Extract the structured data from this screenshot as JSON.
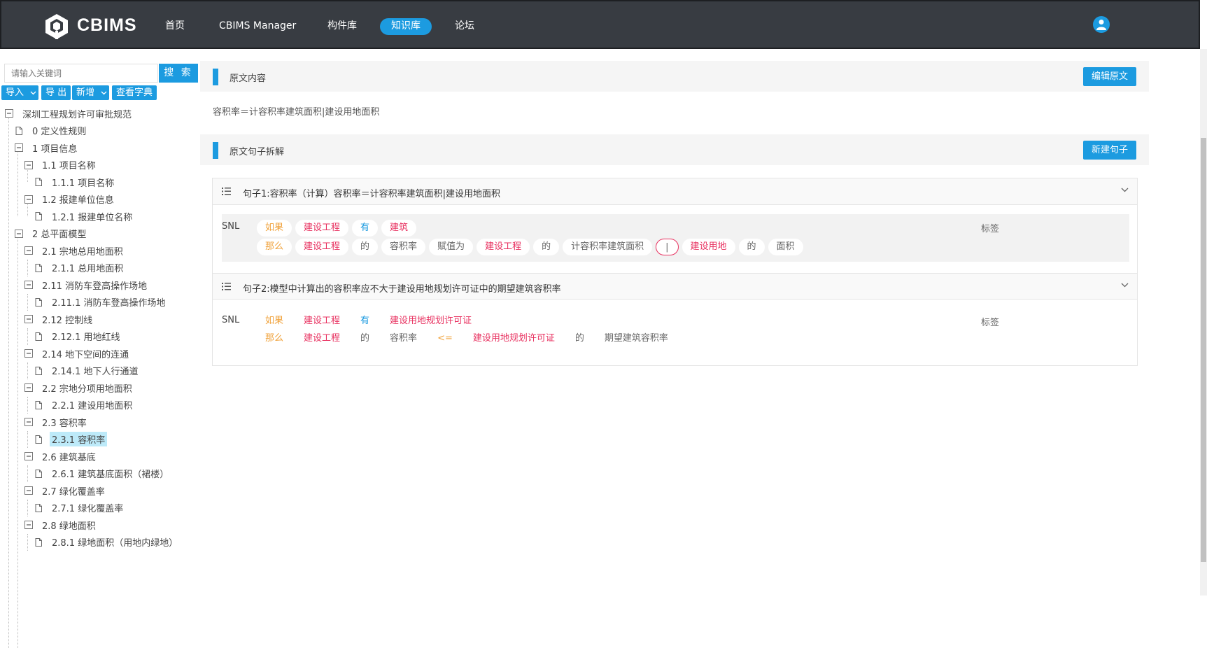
{
  "header": {
    "brand": "CBIMS",
    "nav": [
      "首页",
      "CBIMS Manager",
      "构件库",
      "知识库",
      "论坛"
    ],
    "active_nav": "知识库"
  },
  "sidebar": {
    "search_placeholder": "请输入关键词",
    "search_button": "搜 索",
    "tools": {
      "import": "导入",
      "export": "导 出",
      "add": "新增",
      "dictionary": "查看字典"
    },
    "tree": [
      {
        "label": "深圳工程规划许可审批规范",
        "level": 0,
        "type": "folder"
      },
      {
        "label": "0 定义性规则",
        "level": 1,
        "type": "file"
      },
      {
        "label": "1 项目信息",
        "level": 1,
        "type": "folder"
      },
      {
        "label": "1.1 项目名称",
        "level": 2,
        "type": "folder"
      },
      {
        "label": "1.1.1 项目名称",
        "level": 3,
        "type": "file"
      },
      {
        "label": "1.2 报建单位信息",
        "level": 2,
        "type": "folder"
      },
      {
        "label": "1.2.1 报建单位名称",
        "level": 3,
        "type": "file"
      },
      {
        "label": "2 总平面模型",
        "level": 1,
        "type": "folder"
      },
      {
        "label": "2.1 宗地总用地面积",
        "level": 2,
        "type": "folder"
      },
      {
        "label": "2.1.1 总用地面积",
        "level": 3,
        "type": "file"
      },
      {
        "label": "2.11 消防车登高操作场地",
        "level": 2,
        "type": "folder"
      },
      {
        "label": "2.11.1 消防车登高操作场地",
        "level": 3,
        "type": "file"
      },
      {
        "label": "2.12 控制线",
        "level": 2,
        "type": "folder"
      },
      {
        "label": "2.12.1 用地红线",
        "level": 3,
        "type": "file"
      },
      {
        "label": "2.14 地下空间的连通",
        "level": 2,
        "type": "folder"
      },
      {
        "label": "2.14.1 地下人行通道",
        "level": 3,
        "type": "file"
      },
      {
        "label": "2.2 宗地分项用地面积",
        "level": 2,
        "type": "folder"
      },
      {
        "label": "2.2.1 建设用地面积",
        "level": 3,
        "type": "file"
      },
      {
        "label": "2.3 容积率",
        "level": 2,
        "type": "folder"
      },
      {
        "label": "2.3.1 容积率",
        "level": 3,
        "type": "file",
        "selected": true
      },
      {
        "label": "2.6 建筑基底",
        "level": 2,
        "type": "folder"
      },
      {
        "label": "2.6.1 建筑基底面积（裙楼）",
        "level": 3,
        "type": "file"
      },
      {
        "label": "2.7 绿化覆盖率",
        "level": 2,
        "type": "folder"
      },
      {
        "label": "2.7.1 绿化覆盖率",
        "level": 3,
        "type": "file"
      },
      {
        "label": "2.8 绿地面积",
        "level": 2,
        "type": "folder"
      },
      {
        "label": "2.8.1 绿地面积（用地内绿地）",
        "level": 3,
        "type": "file"
      }
    ]
  },
  "original": {
    "title": "原文内容",
    "edit_button": "编辑原文",
    "text": "容积率＝计容积率建筑面积|建设用地面积"
  },
  "decomposition": {
    "title": "原文句子拆解",
    "new_button": "新建句子",
    "sentences": [
      {
        "title": "句子1:容积率（计算）容积率＝计容积率建筑面积|建设用地面积",
        "snl_label": "SNL",
        "tag_label": "标签",
        "rows": [
          [
            [
              "如果",
              "orange"
            ],
            [
              "建设工程",
              "red"
            ],
            [
              "有",
              "blue"
            ],
            [
              "建筑",
              "red"
            ]
          ],
          [
            [
              "那么",
              "orange"
            ],
            [
              "建设工程",
              "red"
            ],
            [
              "的",
              "gray"
            ],
            [
              "容积率",
              "gray"
            ],
            [
              "赋值为",
              "gray"
            ],
            [
              "建设工程",
              "red"
            ],
            [
              "的",
              "gray"
            ],
            [
              "计容积率建筑面积",
              "gray"
            ],
            [
              "|",
              "circ"
            ],
            [
              "建设用地",
              "red"
            ],
            [
              "的",
              "gray"
            ],
            [
              "面积",
              "gray"
            ]
          ]
        ]
      },
      {
        "title": "句子2:模型中计算出的容积率应不大于建设用地规划许可证中的期望建筑容积率",
        "snl_label": "SNL",
        "tag_label": "标签",
        "rows": [
          [
            [
              "如果",
              "orange"
            ],
            [
              "建设工程",
              "red"
            ],
            [
              "有",
              "blue"
            ],
            [
              "建设用地规划许可证",
              "red"
            ]
          ],
          [
            [
              "那么",
              "orange"
            ],
            [
              "建设工程",
              "red"
            ],
            [
              "的",
              "gray"
            ],
            [
              "容积率",
              "gray"
            ],
            [
              "<=",
              "orange"
            ],
            [
              "建设用地规划许可证",
              "red"
            ],
            [
              "的",
              "gray"
            ],
            [
              "期望建筑容积率",
              "gray"
            ]
          ]
        ]
      }
    ]
  },
  "colors": {
    "accent": "#1c9be0",
    "header_bg": "#383c42",
    "token_orange": "#f0a23b",
    "token_red": "#e8305f"
  }
}
